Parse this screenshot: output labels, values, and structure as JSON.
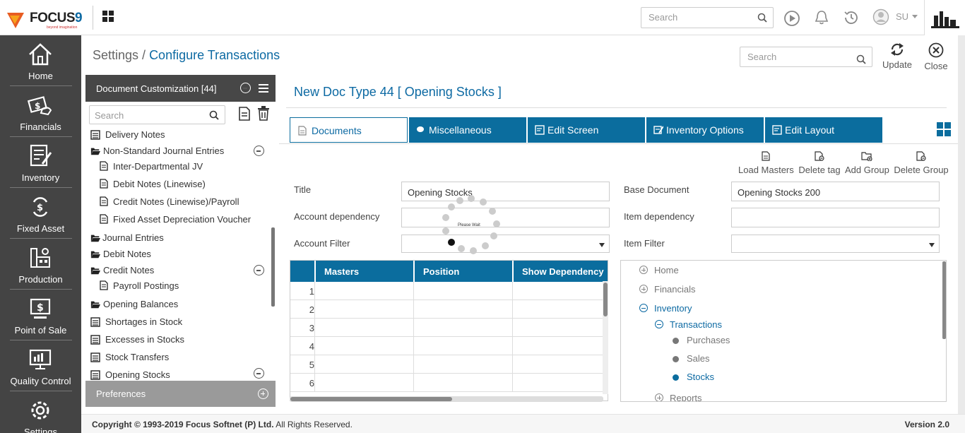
{
  "topbar": {
    "logo_text": "FOCUS",
    "logo_nine": "9",
    "logo_tagline": "beyond imagination",
    "search_placeholder": "Search",
    "user_initials": "SU",
    "icons": [
      "apps-grid-icon",
      "play-icon",
      "bell-icon",
      "history-icon",
      "user-icon",
      "company-logo-icon"
    ]
  },
  "leftnav": {
    "items": [
      {
        "label": "Home",
        "icon": "home-icon"
      },
      {
        "label": "Financials",
        "icon": "financials-icon"
      },
      {
        "label": "Inventory",
        "icon": "inventory-icon"
      },
      {
        "label": "Fixed Asset",
        "icon": "fixed-asset-icon"
      },
      {
        "label": "Production",
        "icon": "production-icon"
      },
      {
        "label": "Point of Sale",
        "icon": "point-of-sale-icon"
      },
      {
        "label": "Quality Control",
        "icon": "quality-control-icon"
      },
      {
        "label": "Settings",
        "icon": "settings-gear-icon"
      }
    ]
  },
  "breadcrumb": {
    "root": "Settings",
    "sep": " / ",
    "current": "Configure Transactions"
  },
  "content_search": {
    "placeholder": "Search"
  },
  "toolbar": {
    "update_label": "Update",
    "close_label": "Close"
  },
  "doc_panel": {
    "title": "Document Customization [44]",
    "search_placeholder": "Search",
    "items": [
      {
        "label": "Delivery Notes",
        "type": "doc",
        "level": 0
      },
      {
        "label": "Non-Standard Journal Entries",
        "type": "folder",
        "level": 0,
        "expanded": true
      },
      {
        "label": "Inter-Departmental JV",
        "type": "doc",
        "level": 1
      },
      {
        "label": "Debit Notes (Linewise)",
        "type": "doc",
        "level": 1
      },
      {
        "label": "Credit Notes (Linewise)/Payroll",
        "type": "doc",
        "level": 1
      },
      {
        "label": "Fixed Asset Depreciation Voucher",
        "type": "doc",
        "level": 1
      },
      {
        "label": "Journal Entries",
        "type": "folder",
        "level": 0
      },
      {
        "label": "Debit Notes",
        "type": "folder",
        "level": 0
      },
      {
        "label": "Credit Notes",
        "type": "folder",
        "level": 0,
        "expanded": true
      },
      {
        "label": "Payroll Postings",
        "type": "doc",
        "level": 1
      },
      {
        "label": "Opening Balances",
        "type": "folder",
        "level": 0
      },
      {
        "label": "Shortages in Stock",
        "type": "list",
        "level": 0
      },
      {
        "label": "Excesses in Stocks",
        "type": "list",
        "level": 0
      },
      {
        "label": "Stock Transfers",
        "type": "list",
        "level": 0
      },
      {
        "label": "Opening Stocks",
        "type": "list",
        "level": 0,
        "expanded": true
      }
    ],
    "preferences_label": "Preferences"
  },
  "main": {
    "doc_title": "New Doc Type 44 [ Opening Stocks ]",
    "tabs": [
      {
        "label": "Documents",
        "active": true
      },
      {
        "label": "Miscellaneous"
      },
      {
        "label": "Edit Screen"
      },
      {
        "label": "Inventory Options"
      },
      {
        "label": "Edit Layout"
      }
    ],
    "actions": [
      "Load Masters",
      "Delete tag",
      "Add Group",
      "Delete Group"
    ],
    "form": {
      "title_label": "Title",
      "title_value": "Opening Stocks",
      "base_doc_label": "Base Document",
      "base_doc_value": "Opening Stocks 200",
      "account_dep_label": "Account dependency",
      "item_dep_label": "Item dependency",
      "account_filter_label": "Account Filter",
      "item_filter_label": "Item Filter"
    },
    "table": {
      "columns": [
        "Masters",
        "Position",
        "Show Dependency"
      ],
      "row_numbers": [
        "1",
        "2",
        "3",
        "4",
        "5",
        "6"
      ]
    },
    "loader_text": "Please Wait",
    "module_tree": {
      "items": [
        {
          "label": "Home",
          "state": "collapsed",
          "level": 0
        },
        {
          "label": "Financials",
          "state": "collapsed",
          "level": 0
        },
        {
          "label": "Inventory",
          "state": "expanded",
          "level": 0
        },
        {
          "label": "Transactions",
          "state": "expanded",
          "level": 1
        },
        {
          "label": "Purchases",
          "state": "leaf",
          "level": 2
        },
        {
          "label": "Sales",
          "state": "leaf",
          "level": 2
        },
        {
          "label": "Stocks",
          "state": "selected",
          "level": 2
        },
        {
          "label": "Reports",
          "state": "collapsed",
          "level": 1
        }
      ]
    }
  },
  "footer": {
    "copyright_prefix": "Copyright © 1993-2019 Focus Softnet (P) Ltd.",
    "copyright_suffix": " All Rights Reserved.",
    "version": "Version 2.0"
  },
  "colors": {
    "primary": "#0b6d9e",
    "link": "#0d6aa3",
    "nav_bg": "#444444",
    "panel_head": "#474747"
  }
}
